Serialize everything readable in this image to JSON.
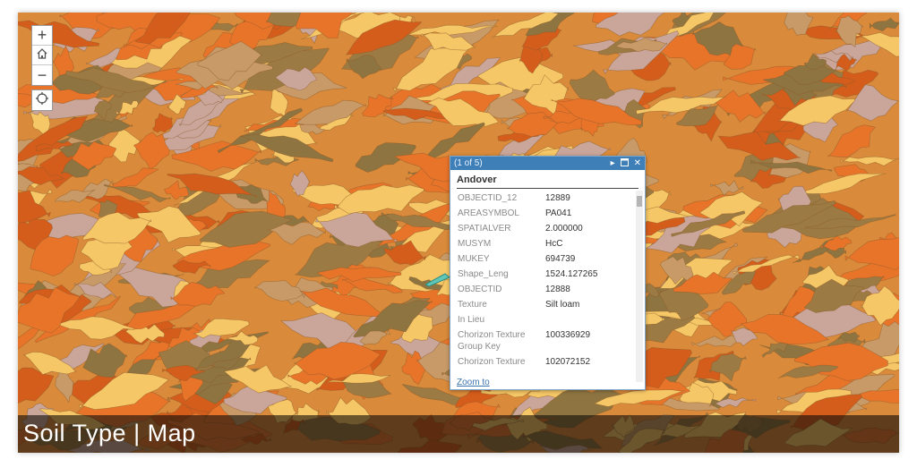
{
  "map": {
    "palette": {
      "base": "#d98a3a",
      "orange": "#e8742a",
      "light_yellow": "#f6c766",
      "tan": "#c89a68",
      "dusty_pink": "#c9a59a",
      "brown": "#9c7a43",
      "olive": "#8e7440",
      "deep_orange": "#d45d1c"
    },
    "highlight_color": "#5fc6b8"
  },
  "controls": {
    "zoom_in_icon": "plus-icon",
    "home_icon": "home-icon",
    "zoom_out_icon": "minus-icon",
    "locate_icon": "locate-icon",
    "zoom_in_label": "+",
    "zoom_out_label": "−"
  },
  "popup": {
    "pager": "(1 of 5)",
    "title": "Andover",
    "rows": [
      {
        "name": "OBJECTID_12",
        "value": "12889"
      },
      {
        "name": "AREASYMBOL",
        "value": "PA041"
      },
      {
        "name": "SPATIALVER",
        "value": "2.000000"
      },
      {
        "name": "MUSYM",
        "value": "HcC"
      },
      {
        "name": "MUKEY",
        "value": "694739"
      },
      {
        "name": "Shape_Leng",
        "value": "1524.127265"
      },
      {
        "name": "OBJECTID",
        "value": "12888"
      },
      {
        "name": "Texture",
        "value": "Silt loam"
      },
      {
        "name": "In Lieu",
        "value": ""
      },
      {
        "name": "Chorizon Texture Group Key",
        "value": "100336929"
      },
      {
        "name": "Chorizon Texture",
        "value": "102072152"
      }
    ],
    "zoom_link": "Zoom to",
    "header_colors": {
      "bar": "#3e7fb8"
    }
  },
  "footer": {
    "title": "Soil Type | Map"
  }
}
